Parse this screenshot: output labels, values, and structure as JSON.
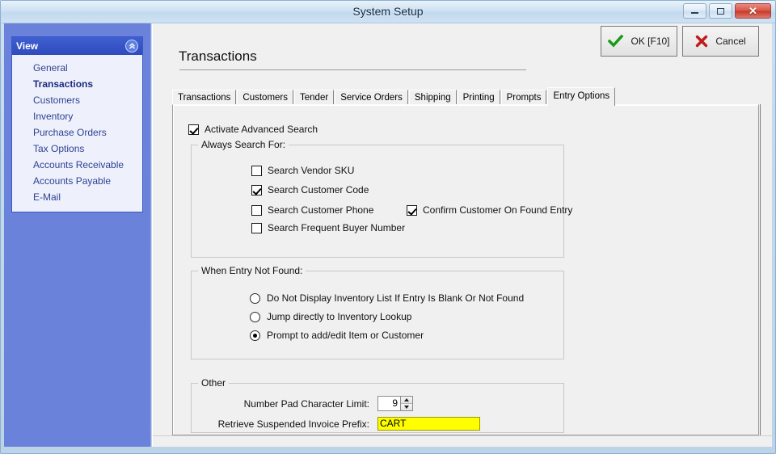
{
  "window": {
    "title": "System Setup",
    "controls": {
      "minimize": "minimize",
      "restore": "restore",
      "close": "close"
    }
  },
  "sidebar": {
    "header": "View",
    "collapse_tooltip": "Collapse",
    "items": [
      {
        "label": "General",
        "active": false
      },
      {
        "label": "Transactions",
        "active": true
      },
      {
        "label": "Customers",
        "active": false
      },
      {
        "label": "Inventory",
        "active": false
      },
      {
        "label": "Purchase Orders",
        "active": false
      },
      {
        "label": "Tax Options",
        "active": false
      },
      {
        "label": "Accounts Receivable",
        "active": false
      },
      {
        "label": "Accounts Payable",
        "active": false
      },
      {
        "label": "E-Mail",
        "active": false
      }
    ]
  },
  "header": {
    "page_title": "Transactions",
    "ok_label": "OK [F10]",
    "cancel_label": "Cancel"
  },
  "tabs": [
    {
      "label": "Transactions",
      "active": false
    },
    {
      "label": "Customers",
      "active": false
    },
    {
      "label": "Tender",
      "active": false
    },
    {
      "label": "Service Orders",
      "active": false
    },
    {
      "label": "Shipping",
      "active": false
    },
    {
      "label": "Printing",
      "active": false
    },
    {
      "label": "Prompts",
      "active": false
    },
    {
      "label": "Entry Options",
      "active": true
    }
  ],
  "main": {
    "activate_advanced_search": {
      "label": "Activate Advanced Search",
      "checked": true
    },
    "always_search_for": {
      "legend": "Always Search For:",
      "options": [
        {
          "label": "Search Vendor SKU",
          "checked": false
        },
        {
          "label": "Search Customer Code",
          "checked": true
        },
        {
          "label": "Search Customer Phone",
          "checked": false
        },
        {
          "label": "Search Frequent Buyer Number",
          "checked": false
        }
      ],
      "confirm_customer": {
        "label": "Confirm Customer On Found Entry",
        "checked": true
      }
    },
    "when_entry_not_found": {
      "legend": "When Entry Not Found:",
      "options": [
        {
          "label": "Do Not Display Inventory List If Entry Is Blank Or Not Found",
          "selected": false
        },
        {
          "label": "Jump directly to Inventory Lookup",
          "selected": false
        },
        {
          "label": "Prompt to add/edit Item or Customer",
          "selected": true
        }
      ]
    },
    "other": {
      "legend": "Other",
      "number_pad_label": "Number Pad Character Limit:",
      "number_pad_value": "9",
      "invoice_prefix_label": "Retrieve Suspended Invoice Prefix:",
      "invoice_prefix_value": "CART"
    }
  },
  "colors": {
    "sidebar_blue": "#6b82da",
    "sidebar_header_blue": "#2f4bbd",
    "sidebar_link": "#2f3f93",
    "highlight_yellow": "#ffff00",
    "ok_green": "#169b16",
    "cancel_red": "#c01b1b",
    "panel_gray": "#f0f0f0"
  }
}
